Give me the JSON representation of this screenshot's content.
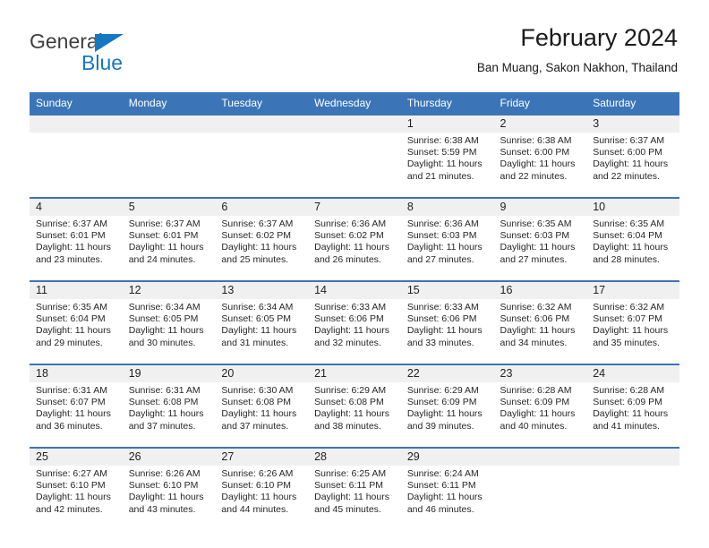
{
  "brand": {
    "name_part1": "General",
    "name_part2": "Blue",
    "triangle_color": "#1678c2"
  },
  "header": {
    "title": "February 2024",
    "subtitle": "Ban Muang, Sakon Nakhon, Thailand"
  },
  "colors": {
    "header_blue": "#3b75b8",
    "day_number_bg": "#f0f0f0",
    "text": "#222222"
  },
  "calendar": {
    "weekday_headers": [
      "Sunday",
      "Monday",
      "Tuesday",
      "Wednesday",
      "Thursday",
      "Friday",
      "Saturday"
    ],
    "weeks": [
      [
        {
          "day": "",
          "sunrise": "",
          "sunset": "",
          "daylight_1": "",
          "daylight_2": ""
        },
        {
          "day": "",
          "sunrise": "",
          "sunset": "",
          "daylight_1": "",
          "daylight_2": ""
        },
        {
          "day": "",
          "sunrise": "",
          "sunset": "",
          "daylight_1": "",
          "daylight_2": ""
        },
        {
          "day": "",
          "sunrise": "",
          "sunset": "",
          "daylight_1": "",
          "daylight_2": ""
        },
        {
          "day": "1",
          "sunrise": "Sunrise: 6:38 AM",
          "sunset": "Sunset: 5:59 PM",
          "daylight_1": "Daylight: 11 hours",
          "daylight_2": "and 21 minutes."
        },
        {
          "day": "2",
          "sunrise": "Sunrise: 6:38 AM",
          "sunset": "Sunset: 6:00 PM",
          "daylight_1": "Daylight: 11 hours",
          "daylight_2": "and 22 minutes."
        },
        {
          "day": "3",
          "sunrise": "Sunrise: 6:37 AM",
          "sunset": "Sunset: 6:00 PM",
          "daylight_1": "Daylight: 11 hours",
          "daylight_2": "and 22 minutes."
        }
      ],
      [
        {
          "day": "4",
          "sunrise": "Sunrise: 6:37 AM",
          "sunset": "Sunset: 6:01 PM",
          "daylight_1": "Daylight: 11 hours",
          "daylight_2": "and 23 minutes."
        },
        {
          "day": "5",
          "sunrise": "Sunrise: 6:37 AM",
          "sunset": "Sunset: 6:01 PM",
          "daylight_1": "Daylight: 11 hours",
          "daylight_2": "and 24 minutes."
        },
        {
          "day": "6",
          "sunrise": "Sunrise: 6:37 AM",
          "sunset": "Sunset: 6:02 PM",
          "daylight_1": "Daylight: 11 hours",
          "daylight_2": "and 25 minutes."
        },
        {
          "day": "7",
          "sunrise": "Sunrise: 6:36 AM",
          "sunset": "Sunset: 6:02 PM",
          "daylight_1": "Daylight: 11 hours",
          "daylight_2": "and 26 minutes."
        },
        {
          "day": "8",
          "sunrise": "Sunrise: 6:36 AM",
          "sunset": "Sunset: 6:03 PM",
          "daylight_1": "Daylight: 11 hours",
          "daylight_2": "and 27 minutes."
        },
        {
          "day": "9",
          "sunrise": "Sunrise: 6:35 AM",
          "sunset": "Sunset: 6:03 PM",
          "daylight_1": "Daylight: 11 hours",
          "daylight_2": "and 27 minutes."
        },
        {
          "day": "10",
          "sunrise": "Sunrise: 6:35 AM",
          "sunset": "Sunset: 6:04 PM",
          "daylight_1": "Daylight: 11 hours",
          "daylight_2": "and 28 minutes."
        }
      ],
      [
        {
          "day": "11",
          "sunrise": "Sunrise: 6:35 AM",
          "sunset": "Sunset: 6:04 PM",
          "daylight_1": "Daylight: 11 hours",
          "daylight_2": "and 29 minutes."
        },
        {
          "day": "12",
          "sunrise": "Sunrise: 6:34 AM",
          "sunset": "Sunset: 6:05 PM",
          "daylight_1": "Daylight: 11 hours",
          "daylight_2": "and 30 minutes."
        },
        {
          "day": "13",
          "sunrise": "Sunrise: 6:34 AM",
          "sunset": "Sunset: 6:05 PM",
          "daylight_1": "Daylight: 11 hours",
          "daylight_2": "and 31 minutes."
        },
        {
          "day": "14",
          "sunrise": "Sunrise: 6:33 AM",
          "sunset": "Sunset: 6:06 PM",
          "daylight_1": "Daylight: 11 hours",
          "daylight_2": "and 32 minutes."
        },
        {
          "day": "15",
          "sunrise": "Sunrise: 6:33 AM",
          "sunset": "Sunset: 6:06 PM",
          "daylight_1": "Daylight: 11 hours",
          "daylight_2": "and 33 minutes."
        },
        {
          "day": "16",
          "sunrise": "Sunrise: 6:32 AM",
          "sunset": "Sunset: 6:06 PM",
          "daylight_1": "Daylight: 11 hours",
          "daylight_2": "and 34 minutes."
        },
        {
          "day": "17",
          "sunrise": "Sunrise: 6:32 AM",
          "sunset": "Sunset: 6:07 PM",
          "daylight_1": "Daylight: 11 hours",
          "daylight_2": "and 35 minutes."
        }
      ],
      [
        {
          "day": "18",
          "sunrise": "Sunrise: 6:31 AM",
          "sunset": "Sunset: 6:07 PM",
          "daylight_1": "Daylight: 11 hours",
          "daylight_2": "and 36 minutes."
        },
        {
          "day": "19",
          "sunrise": "Sunrise: 6:31 AM",
          "sunset": "Sunset: 6:08 PM",
          "daylight_1": "Daylight: 11 hours",
          "daylight_2": "and 37 minutes."
        },
        {
          "day": "20",
          "sunrise": "Sunrise: 6:30 AM",
          "sunset": "Sunset: 6:08 PM",
          "daylight_1": "Daylight: 11 hours",
          "daylight_2": "and 37 minutes."
        },
        {
          "day": "21",
          "sunrise": "Sunrise: 6:29 AM",
          "sunset": "Sunset: 6:08 PM",
          "daylight_1": "Daylight: 11 hours",
          "daylight_2": "and 38 minutes."
        },
        {
          "day": "22",
          "sunrise": "Sunrise: 6:29 AM",
          "sunset": "Sunset: 6:09 PM",
          "daylight_1": "Daylight: 11 hours",
          "daylight_2": "and 39 minutes."
        },
        {
          "day": "23",
          "sunrise": "Sunrise: 6:28 AM",
          "sunset": "Sunset: 6:09 PM",
          "daylight_1": "Daylight: 11 hours",
          "daylight_2": "and 40 minutes."
        },
        {
          "day": "24",
          "sunrise": "Sunrise: 6:28 AM",
          "sunset": "Sunset: 6:09 PM",
          "daylight_1": "Daylight: 11 hours",
          "daylight_2": "and 41 minutes."
        }
      ],
      [
        {
          "day": "25",
          "sunrise": "Sunrise: 6:27 AM",
          "sunset": "Sunset: 6:10 PM",
          "daylight_1": "Daylight: 11 hours",
          "daylight_2": "and 42 minutes."
        },
        {
          "day": "26",
          "sunrise": "Sunrise: 6:26 AM",
          "sunset": "Sunset: 6:10 PM",
          "daylight_1": "Daylight: 11 hours",
          "daylight_2": "and 43 minutes."
        },
        {
          "day": "27",
          "sunrise": "Sunrise: 6:26 AM",
          "sunset": "Sunset: 6:10 PM",
          "daylight_1": "Daylight: 11 hours",
          "daylight_2": "and 44 minutes."
        },
        {
          "day": "28",
          "sunrise": "Sunrise: 6:25 AM",
          "sunset": "Sunset: 6:11 PM",
          "daylight_1": "Daylight: 11 hours",
          "daylight_2": "and 45 minutes."
        },
        {
          "day": "29",
          "sunrise": "Sunrise: 6:24 AM",
          "sunset": "Sunset: 6:11 PM",
          "daylight_1": "Daylight: 11 hours",
          "daylight_2": "and 46 minutes."
        },
        {
          "day": "",
          "sunrise": "",
          "sunset": "",
          "daylight_1": "",
          "daylight_2": ""
        },
        {
          "day": "",
          "sunrise": "",
          "sunset": "",
          "daylight_1": "",
          "daylight_2": ""
        }
      ]
    ]
  }
}
